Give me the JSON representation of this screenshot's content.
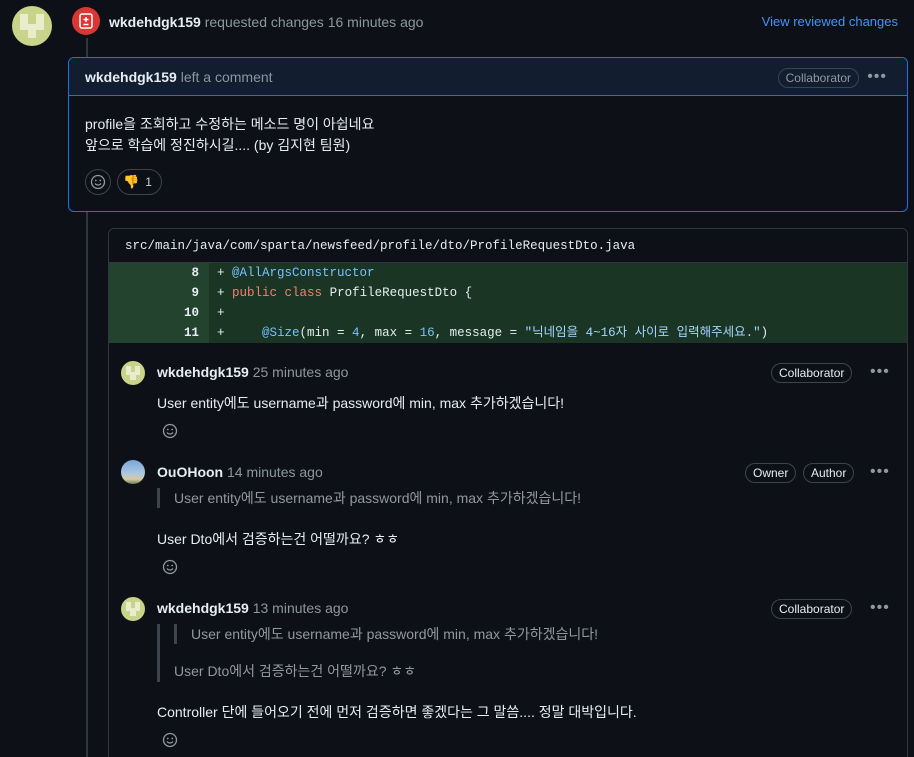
{
  "review": {
    "author": "wkdehdgk159",
    "action": "requested changes",
    "time": "16 minutes ago",
    "view_reviewed": "View reviewed changes"
  },
  "main_comment": {
    "author": "wkdehdgk159",
    "action": "left a comment",
    "badge": "Collaborator",
    "line1": "profile을 조회하고 수정하는 메소드 명이 아쉽네요",
    "line2": "앞으로 학습에 정진하시길.... (by 김지현 팀원)",
    "reaction_count": "1"
  },
  "file": {
    "path": "src/main/java/com/sparta/newsfeed/profile/dto/ProfileRequestDto.java",
    "lines": [
      {
        "num": "8"
      },
      {
        "num": "9"
      },
      {
        "num": "10"
      },
      {
        "num": "11"
      }
    ]
  },
  "code": {
    "l8_plus": "+ ",
    "l8_anno": "@AllArgsConstructor",
    "l9_plus": "+ ",
    "l9_kw1": "public",
    "l9_kw2": "class",
    "l9_rest": " ProfileRequestDto {",
    "l10_plus": "+",
    "l11_plus": "+     ",
    "l11_anno": "@Size",
    "l11_a": "(min = ",
    "l11_n1": "4",
    "l11_b": ", max = ",
    "l11_n2": "16",
    "l11_c": ", message = ",
    "l11_str": "\"닉네임을 4~16자 사이로 입력해주세요.\"",
    "l11_d": ")"
  },
  "thread": [
    {
      "author": "wkdehdgk159",
      "time": "25 minutes ago",
      "badge": "Collaborator",
      "text": "User entity에도 username과 password에 min, max 추가하겠습니다!"
    },
    {
      "author": "OuOHoon",
      "time": "14 minutes ago",
      "badge1": "Owner",
      "badge2": "Author",
      "quote": "User entity에도 username과 password에 min, max 추가하겠습니다!",
      "text": "User Dto에서 검증하는건 어떨까요? ㅎㅎ"
    },
    {
      "author": "wkdehdgk159",
      "time": "13 minutes ago",
      "badge": "Collaborator",
      "quote_nested": "User entity에도 username과 password에 min, max 추가하겠습니다!",
      "quote": "User Dto에서 검증하는건 어떨까요? ㅎㅎ",
      "text": "Controller 단에 들어오기 전에 먼저 검증하면 좋겠다는 그 말씀.... 정말 대박입니다."
    }
  ],
  "icons": {
    "review_badge": "file-diff-icon",
    "smile": "smiley-icon",
    "reaction": "thumbs-down-icon",
    "more": "kebab-horizontal-icon"
  },
  "colors": {
    "bg": "#0d1117",
    "accent_blue": "#4493f8",
    "changes_red": "#da3633",
    "diff_added_bg": "#1a3524"
  }
}
